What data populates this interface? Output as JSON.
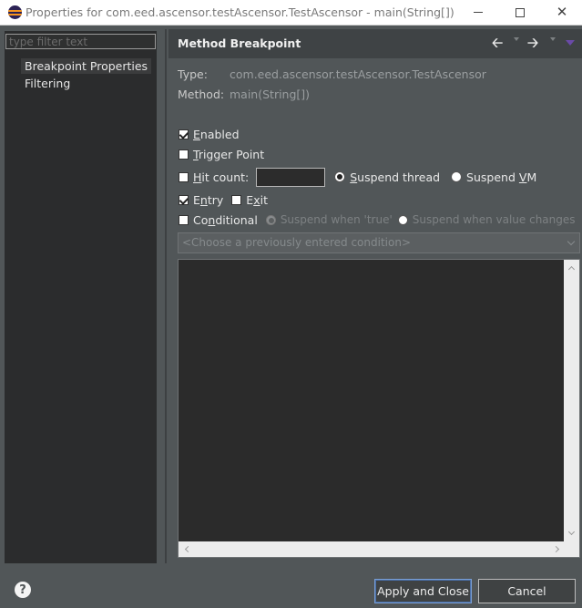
{
  "window": {
    "title": "Properties for com.eed.ascensor.testAscensor.TestAscensor - main(String[])",
    "minimize_label": "—",
    "close_label": "✕"
  },
  "sidebar": {
    "filter_placeholder": "type filter text",
    "items": [
      {
        "label": "Breakpoint Properties",
        "selected": true
      },
      {
        "label": "Filtering",
        "selected": false
      }
    ]
  },
  "page": {
    "title": "Method Breakpoint",
    "nav": {
      "back_icon": "back-arrow-icon",
      "forward_icon": "forward-arrow-icon",
      "menu_icon": "view-menu-icon"
    }
  },
  "details": {
    "type_label": "Type:",
    "type_value": "com.eed.ascensor.testAscensor.TestAscensor",
    "method_label": "Method:",
    "method_value": "main(String[])"
  },
  "options": {
    "enabled": {
      "pre": "",
      "u": "E",
      "post": "nabled",
      "checked": true
    },
    "trigger_point": {
      "pre": "",
      "u": "T",
      "post": "rigger Point",
      "checked": false
    },
    "hit_count": {
      "pre": "",
      "u": "H",
      "post": "it count:",
      "checked": false,
      "value": ""
    },
    "suspend_thread": {
      "pre": "",
      "u": "S",
      "post": "uspend thread",
      "checked": true
    },
    "suspend_vm": {
      "pre": "Suspend ",
      "u": "V",
      "post": "M",
      "checked": false
    },
    "entry": {
      "pre": "E",
      "u": "n",
      "post": "try",
      "checked": true
    },
    "exit": {
      "pre": "E",
      "u": "x",
      "post": "it",
      "checked": false
    },
    "conditional": {
      "pre": "Co",
      "u": "n",
      "post": "ditional",
      "checked": false
    },
    "suspend_when_true": {
      "label": "Suspend when 'true'",
      "checked": true
    },
    "suspend_when_changes": {
      "label": "Suspend when value changes",
      "checked": false
    }
  },
  "condition": {
    "combo_placeholder": "<Choose a previously entered condition>",
    "editor_text": ""
  },
  "footer": {
    "help_label": "?",
    "apply_label": "Apply and Close",
    "cancel_label": "Cancel"
  },
  "colors": {
    "background": "#515658",
    "sidebar": "#2b2c2d",
    "header": "#3f4345",
    "editor": "#2b2b2b"
  }
}
